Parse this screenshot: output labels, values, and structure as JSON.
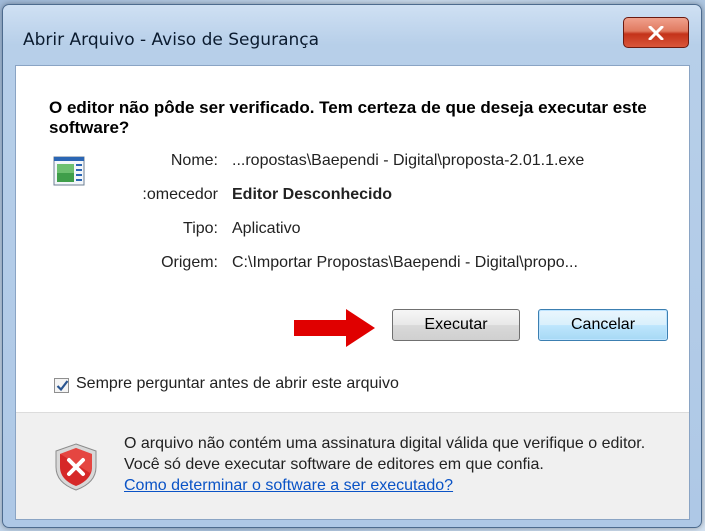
{
  "dialog": {
    "title": "Abrir Arquivo - Aviso de Segurança",
    "heading": "O editor não pôde ser verificado. Tem certeza de que deseja executar este software?",
    "fields": [
      {
        "label": "Nome:",
        "value": "...ropostas\\Baependi - Digital\\proposta-2.01.1.exe"
      },
      {
        "label": "omecedor:",
        "value": "Editor Desconhecido"
      },
      {
        "label": "Tipo:",
        "value": "Aplicativo"
      },
      {
        "label": "Origem:",
        "value": "C:\\Importar Propostas\\Baependi - Digital\\propo..."
      }
    ],
    "buttons": {
      "run": "Executar",
      "cancel": "Cancelar"
    },
    "checkbox": {
      "label": "Sempre perguntar antes de abrir este arquivo",
      "checked": true
    },
    "warning": {
      "text": "O arquivo não contém uma assinatura digital válida que verifique o editor. Você só deve executar software de editores em que confia.",
      "link": "Como determinar o software a ser executado?"
    }
  },
  "icons": {
    "close": "close-icon",
    "app": "application-icon",
    "arrow": "red-arrow-icon",
    "shield": "security-shield-error-icon",
    "check": "checkmark-icon"
  },
  "colors": {
    "arrow": "#e00000",
    "close": "#c4331a",
    "link": "#0a53c6"
  }
}
